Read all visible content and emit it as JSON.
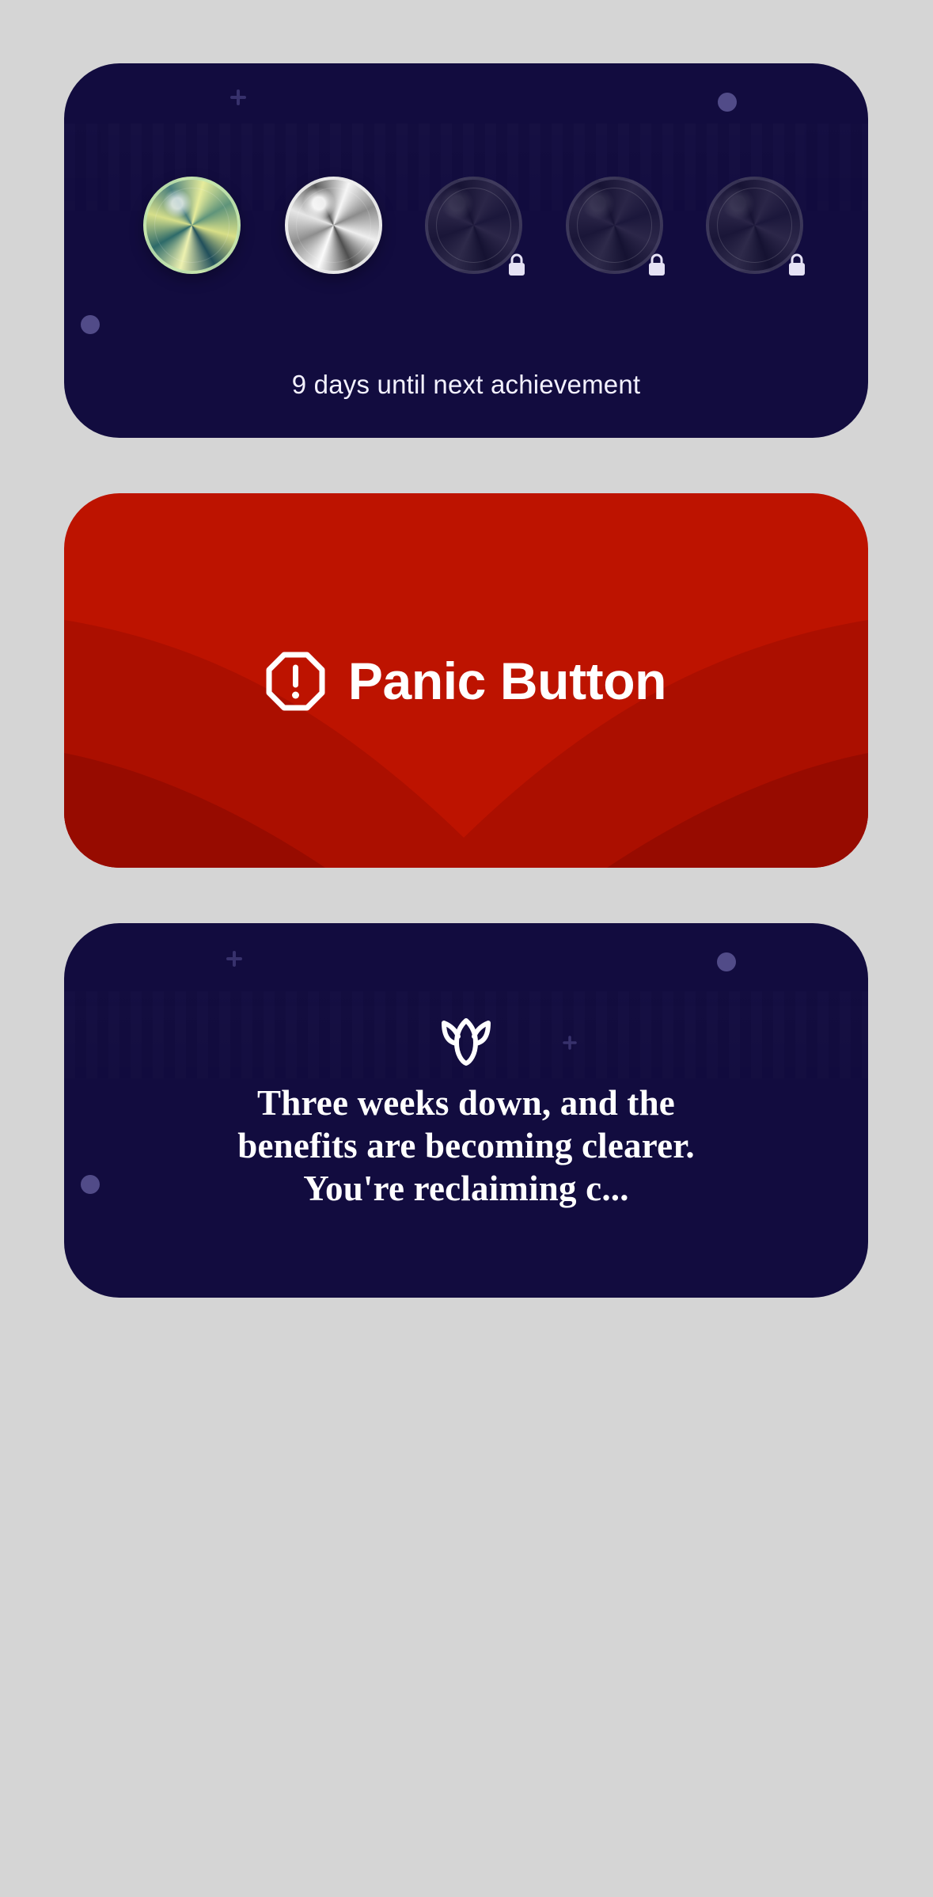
{
  "achievements_card": {
    "progress_text": "9 days until next achievement",
    "medals": [
      {
        "status": "unlocked",
        "style": "gold"
      },
      {
        "status": "unlocked",
        "style": "silver"
      },
      {
        "status": "locked",
        "style": "locked"
      },
      {
        "status": "locked",
        "style": "locked"
      },
      {
        "status": "locked",
        "style": "locked"
      }
    ]
  },
  "panic_button": {
    "label": "Panic Button",
    "icon": "alert-octagon-icon",
    "colors": {
      "primary": "#bd1300",
      "wave_1": "#ab0f00",
      "wave_2": "#970b00",
      "foreground": "#ffffff"
    }
  },
  "message_card": {
    "icon": "tulip-icon",
    "text": "Three weeks down, and the benefits are becoming clearer. You're reclaiming c..."
  },
  "theme": {
    "background": "#d5d5d5",
    "dark_card": "#120c3f",
    "light_text": "#f3f1ff"
  }
}
